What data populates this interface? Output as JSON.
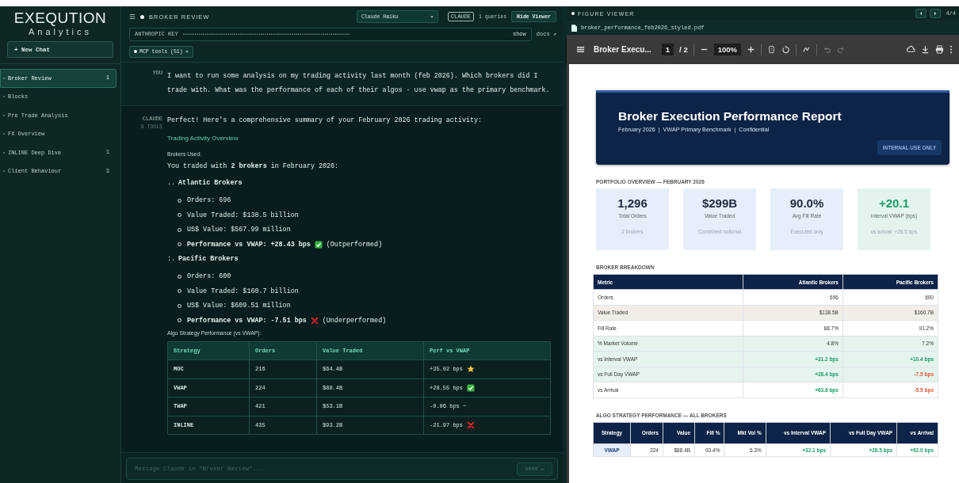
{
  "sidebar": {
    "brand": "EXEQUTION",
    "tagline": "Analytics",
    "new_chat": "+ New Chat",
    "chats": [
      {
        "label": "Broker Review",
        "count": "1",
        "selected": true
      },
      {
        "label": "Blocks",
        "selected": false
      },
      {
        "label": "Pre Trade Analysis",
        "selected": false
      },
      {
        "label": "FX Overview",
        "selected": false
      },
      {
        "label": "INLINE Deep Dive",
        "count": "1",
        "selected": false
      },
      {
        "label": "Client Behaviour",
        "count": "3",
        "selected": false
      }
    ]
  },
  "chat": {
    "header": {
      "title": "BROKER REVIEW",
      "model": "Claude Haiku",
      "provider": "CLAUDE",
      "queries": "1 queries",
      "hide_viewer": "Hide Viewer"
    },
    "key": {
      "label": "ANTHROPIC KEY",
      "mask": "••••••••••••••••••••••••••••••••••••••••••••••••••••••••••••••••••••••••••••••••••••••",
      "show": "show",
      "docs": "docs ↗"
    },
    "mcp": "MCP tools (51)",
    "messages": [
      {
        "kind": "user",
        "label": "YOU",
        "text": "I want to run some analysis on my trading activity last month (feb 2026). Which brokers did I trade with. What was the performance of each of their algos - use vwap as the primary benchmark."
      },
      {
        "kind": "assistant",
        "label": "CLAUDE",
        "tools": "9 TOOLS",
        "blocks": [
          {
            "kind": "text",
            "text": "Perfect! Here's a comprehensive summary of your February 2026 trading activity:"
          },
          {
            "kind": "heading",
            "text": "Trading Activity Overview"
          },
          {
            "kind": "label",
            "text": "Brokers Used:"
          },
          {
            "kind": "text",
            "text": "You traded with **2 brokers** in February 2026:"
          },
          {
            "kind": "numbered",
            "marker": "..",
            "text": "Atlantic Brokers",
            "items": [
              {
                "kind": "plain",
                "text": "Orders: 696"
              },
              {
                "kind": "plain",
                "text": "Value Traded: $138.5 billion"
              },
              {
                "kind": "plain",
                "text": "US$ Value: $567.99 million"
              },
              {
                "kind": "check",
                "text": "**Performance vs VWAP: +28.43 bps**",
                "note": "(Outperformed)"
              }
            ]
          },
          {
            "kind": "numbered",
            "marker": ":.",
            "text": "Pacific Brokers",
            "items": [
              {
                "kind": "plain",
                "text": "Orders: 600"
              },
              {
                "kind": "plain",
                "text": "Value Traded: $160.7 billion"
              },
              {
                "kind": "plain",
                "text": "US$ Value: $609.51 million"
              },
              {
                "kind": "cross",
                "text": "**Performance vs VWAP: -7.51 bps**",
                "note": "(Underperformed)"
              }
            ]
          },
          {
            "kind": "label",
            "text": "Algo Strategy Performance (vs VWAP):"
          },
          {
            "kind": "table",
            "columns": [
              "Strategy",
              "Orders",
              "Value Traded",
              "Perf vs VWAP"
            ],
            "rows": [
              {
                "kind": "star",
                "cells": [
                  "MOC",
                  "216",
                  "$64.4B",
                  "+35.02 bps"
                ]
              },
              {
                "kind": "check",
                "cells": [
                  "VWAP",
                  "224",
                  "$88.4B",
                  "+28.55 bps"
                ]
              },
              {
                "kind": "plain",
                "cells": [
                  "TWAP",
                  "421",
                  "$53.1B",
                  "-0.06 bps ~"
                ]
              },
              {
                "kind": "cross",
                "cells": [
                  "INLINE",
                  "435",
                  "$93.2B",
                  "-21.97 bps"
                ]
              }
            ]
          }
        ]
      }
    ],
    "composer": {
      "placeholder": "Message Claude in \"Broker Review\"...",
      "send": "send ↵"
    }
  },
  "viewer": {
    "title": "FIGURE VIEWER",
    "counter": "4/4",
    "file": "broker_performance_feb2026_styled.pdf",
    "toolbar": {
      "doc_title": "Broker Execu...",
      "page": "1",
      "pages": "/ 2",
      "zoom": "100%"
    },
    "report": {
      "title": "Broker Execution Performance Report",
      "subtitle": "February 2026  |  VWAP Primary Benchmark  |  Confidential",
      "badge": "INTERNAL USE ONLY",
      "overview_label": "PORTFOLIO OVERVIEW — FEBRUARY 2026",
      "cards": [
        {
          "kind": "neutral",
          "value": "1,296",
          "label": "Total Orders",
          "note": "2 brokers"
        },
        {
          "kind": "neutral",
          "value": "$299B",
          "label": "Value Traded",
          "note": "Combined notional"
        },
        {
          "kind": "neutral",
          "value": "90.0%",
          "label": "Avg Fill Rate",
          "note": "Executed only"
        },
        {
          "kind": "positive",
          "value": "+20.1",
          "label": "Interval VWAP (bps)",
          "note": "vs arrival: +26.5 bps"
        }
      ],
      "breakdown_label": "BROKER BREAKDOWN",
      "breakdown": {
        "columns": [
          "Metric",
          "Atlantic Brokers",
          "Pacific Brokers"
        ],
        "rows": [
          {
            "color": "#ffffff",
            "metric": "Orders",
            "values": [
              {
                "text": "696",
                "kind": "neutral"
              },
              {
                "text": "600",
                "kind": "neutral"
              }
            ]
          },
          {
            "color": "#f1eee8",
            "metric": "Value Traded",
            "values": [
              {
                "text": "$138.5B",
                "kind": "neutral"
              },
              {
                "text": "$160.7B",
                "kind": "neutral"
              }
            ]
          },
          {
            "color": "#ffffff",
            "metric": "Fill Rate",
            "values": [
              {
                "text": "88.7%",
                "kind": "neutral"
              },
              {
                "text": "91.2%",
                "kind": "neutral"
              }
            ]
          },
          {
            "color": "#e5f4ed",
            "metric": "% Market Volume",
            "values": [
              {
                "text": "4.8%",
                "kind": "neutral"
              },
              {
                "text": "7.2%",
                "kind": "neutral"
              }
            ]
          },
          {
            "color": "#e5f4ed",
            "metric": "vs Interval VWAP",
            "values": [
              {
                "text": "+31.2 bps",
                "kind": "positive"
              },
              {
                "text": "+10.4 bps",
                "kind": "positive"
              }
            ]
          },
          {
            "color": "#e5f4ed",
            "metric": "vs Full Day VWAP",
            "values": [
              {
                "text": "+28.4 bps",
                "kind": "positive"
              },
              {
                "text": "-7.5 bps",
                "kind": "negative"
              }
            ]
          },
          {
            "color": "#ffffff",
            "metric": "vs Arrival",
            "values": [
              {
                "text": "+63.6 bps",
                "kind": "positive"
              },
              {
                "text": "-5.5 bps",
                "kind": "negative"
              }
            ]
          }
        ]
      },
      "algo_label": "ALGO STRATEGY PERFORMANCE — ALL BROKERS",
      "algo": {
        "columns": [
          "Strategy",
          "Orders",
          "Value",
          "Fill %",
          "Mkt Vol %",
          "vs Interval VWAP",
          "vs Full Day VWAP",
          "vs Arrival"
        ],
        "rows": [
          {
            "cells": [
              {
                "text": "VWAP",
                "kind": "strategy"
              },
              {
                "text": "224",
                "kind": "neutral"
              },
              {
                "text": "$88.4B",
                "kind": "neutral"
              },
              {
                "text": "93.4%",
                "kind": "neutral"
              },
              {
                "text": "6.3%",
                "kind": "neutral"
              },
              {
                "text": "+32.1 bps",
                "kind": "positive"
              },
              {
                "text": "+28.5 bps",
                "kind": "positive"
              },
              {
                "text": "+92.0 bps",
                "kind": "positive"
              }
            ]
          }
        ]
      }
    }
  }
}
